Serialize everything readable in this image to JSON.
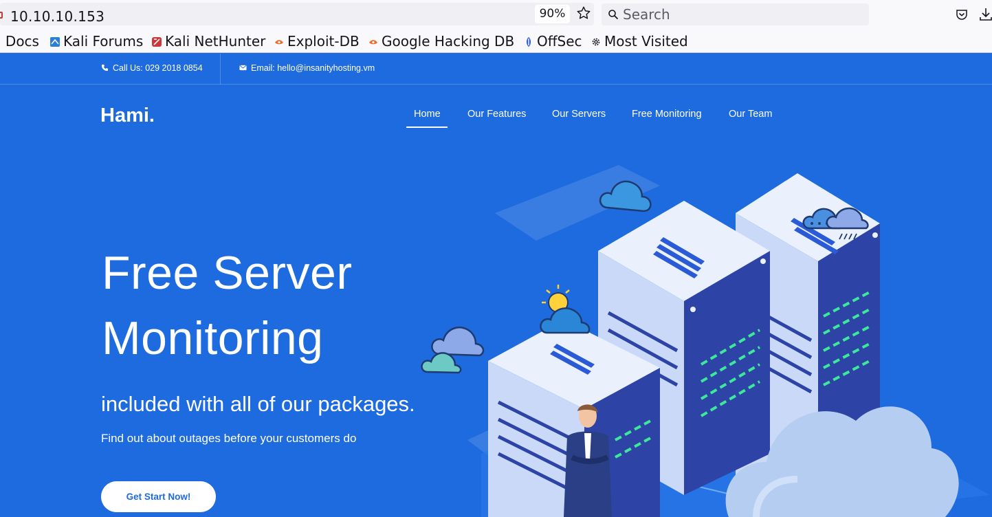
{
  "browser": {
    "url": "10.10.10.153",
    "zoom": "90%",
    "search_placeholder": "Search",
    "bookmarks": [
      {
        "label": "i Docs",
        "icon": "kali-docs-icon"
      },
      {
        "label": "Kali Forums",
        "icon": "kali-forums-icon"
      },
      {
        "label": "Kali NetHunter",
        "icon": "nethunter-icon"
      },
      {
        "label": "Exploit-DB",
        "icon": "exploit-db-icon"
      },
      {
        "label": "Google Hacking DB",
        "icon": "ghdb-icon"
      },
      {
        "label": "OffSec",
        "icon": "offsec-icon"
      },
      {
        "label": "Most Visited",
        "icon": "gear-icon"
      }
    ]
  },
  "topbar": {
    "phone": "Call Us: 029 2018 0854",
    "email": "Email: hello@insanityhosting.vm"
  },
  "header": {
    "logo": "Hami.",
    "nav": [
      {
        "label": "Home",
        "active": true
      },
      {
        "label": "Our Features"
      },
      {
        "label": "Our Servers"
      },
      {
        "label": "Free Monitoring"
      },
      {
        "label": "Our Team"
      }
    ]
  },
  "hero": {
    "title_line1": "Free Server",
    "title_line2": "Monitoring",
    "subtitle": "included with all of our packages.",
    "description": "Find out about outages before your customers do",
    "cta": "Get Start Now!"
  },
  "colors": {
    "page_bg": "#1e6be0",
    "server_light": "#dce8fb",
    "server_dark": "#2b3f9e",
    "led_green": "#3ee89a"
  }
}
